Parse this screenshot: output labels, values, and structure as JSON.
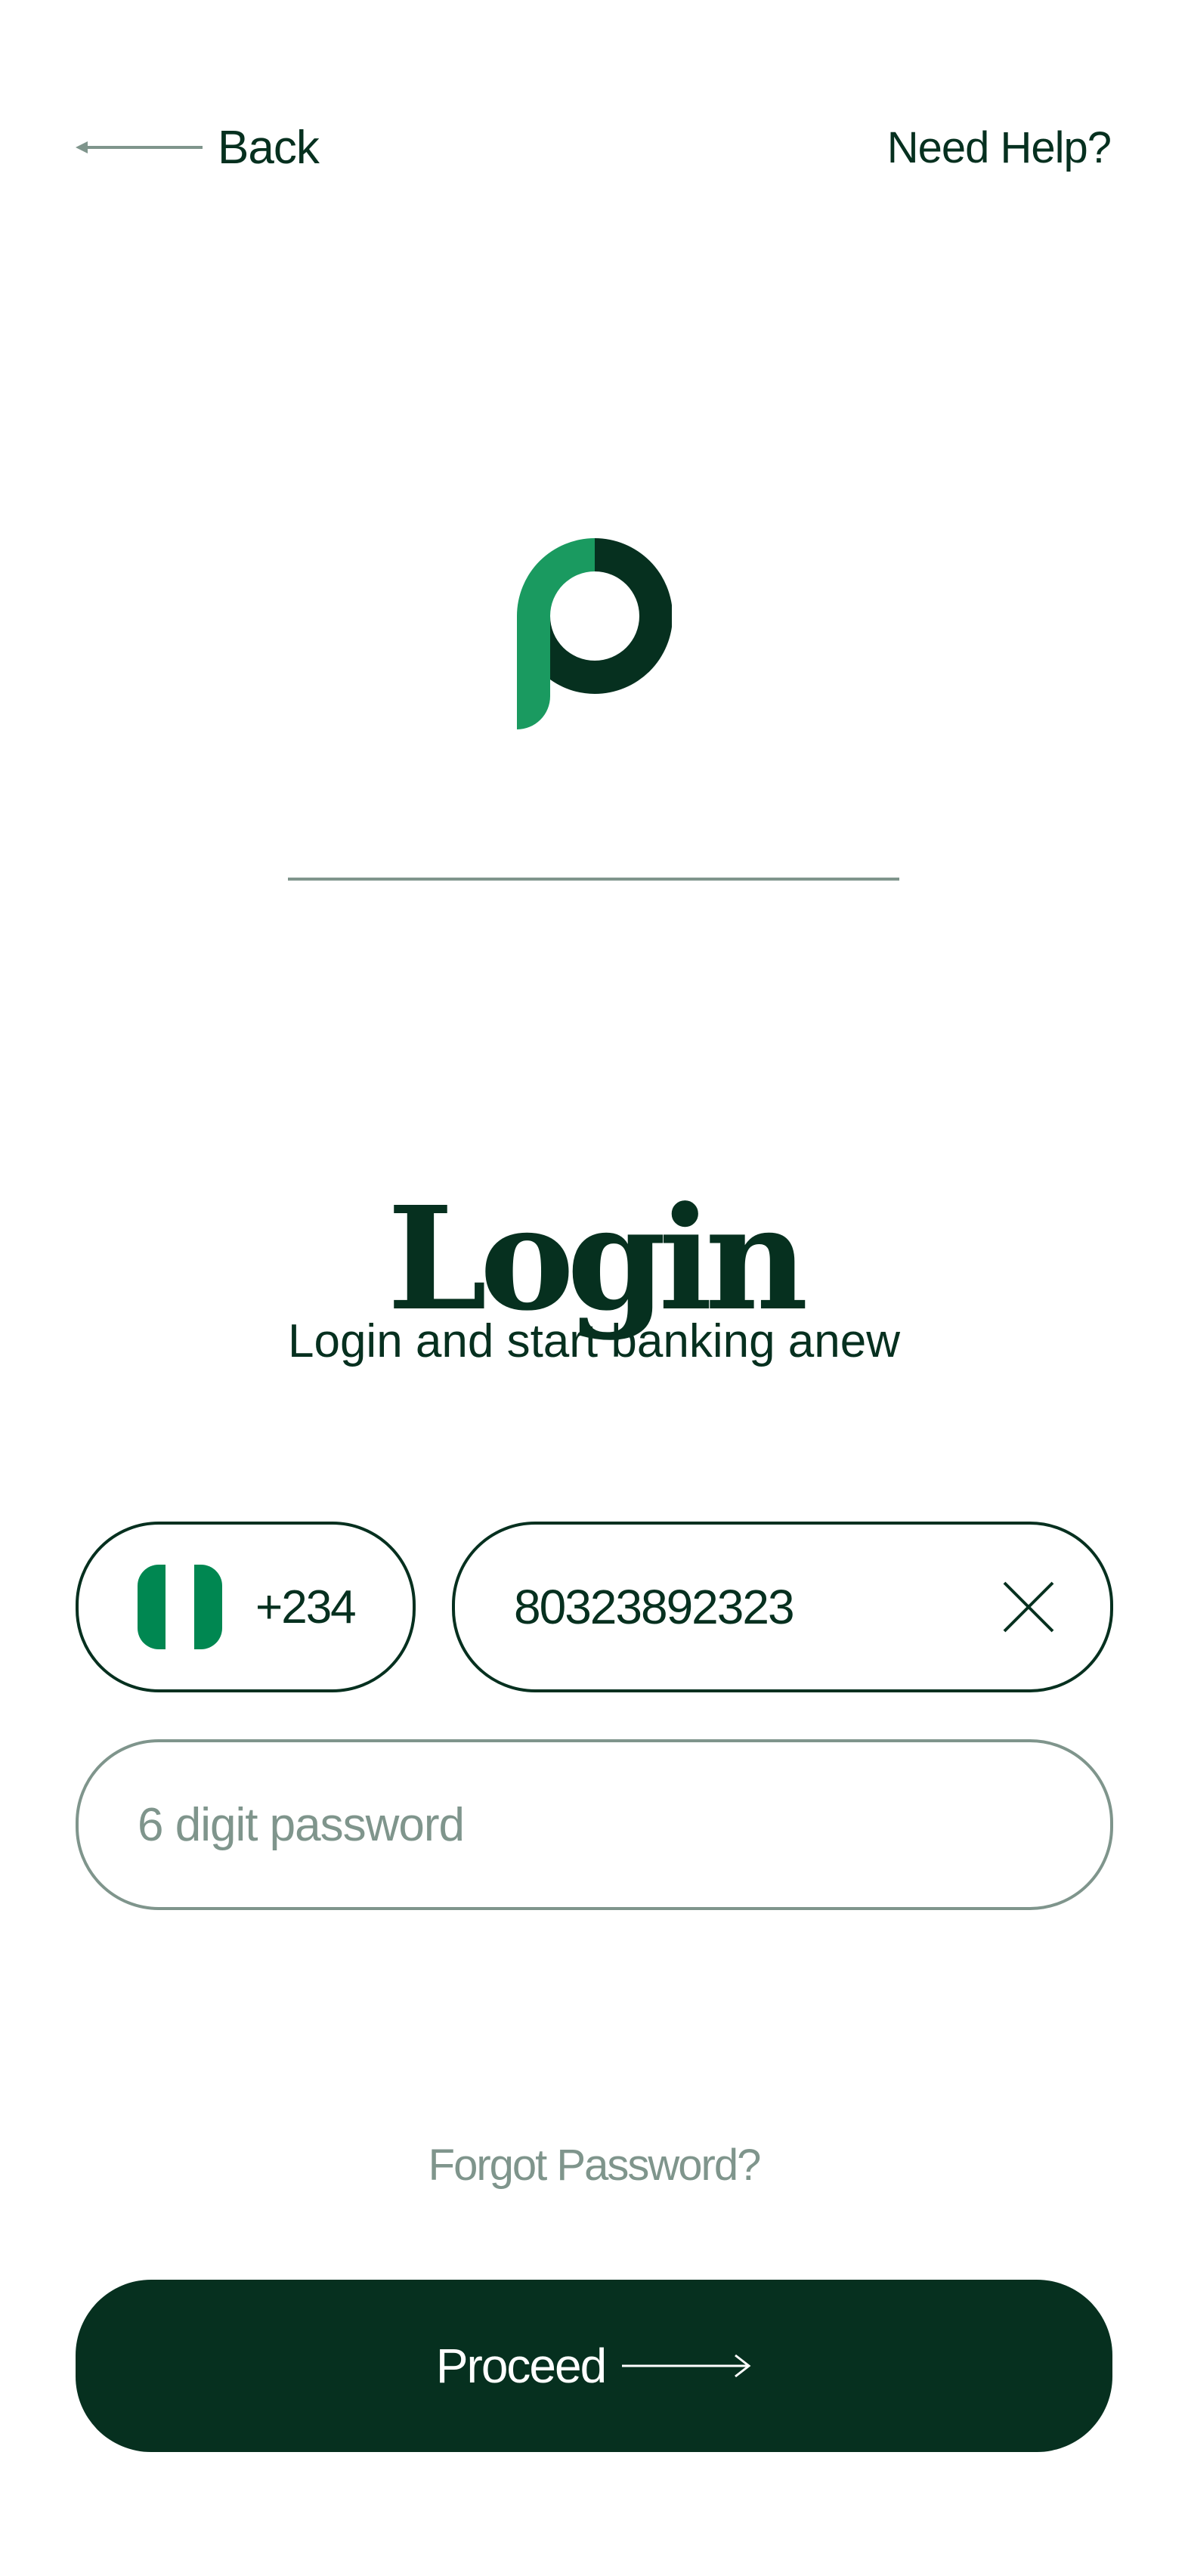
{
  "header": {
    "back_label": "Back",
    "help_label": "Need Help?"
  },
  "login": {
    "title": "Login",
    "subtitle": "Login and start banking anew"
  },
  "phone": {
    "country_flag": "nigeria-flag",
    "dial_code": "+234",
    "number_value": "80323892323"
  },
  "password": {
    "value": "",
    "placeholder": "6 digit password"
  },
  "forgot_label": "Forgot Password?",
  "proceed_label": "Proceed",
  "colors": {
    "primary_dark": "#06301f",
    "accent_green": "#1a9a60",
    "flag_green": "#008751",
    "muted": "#7f958c",
    "background": "#ffffff"
  }
}
